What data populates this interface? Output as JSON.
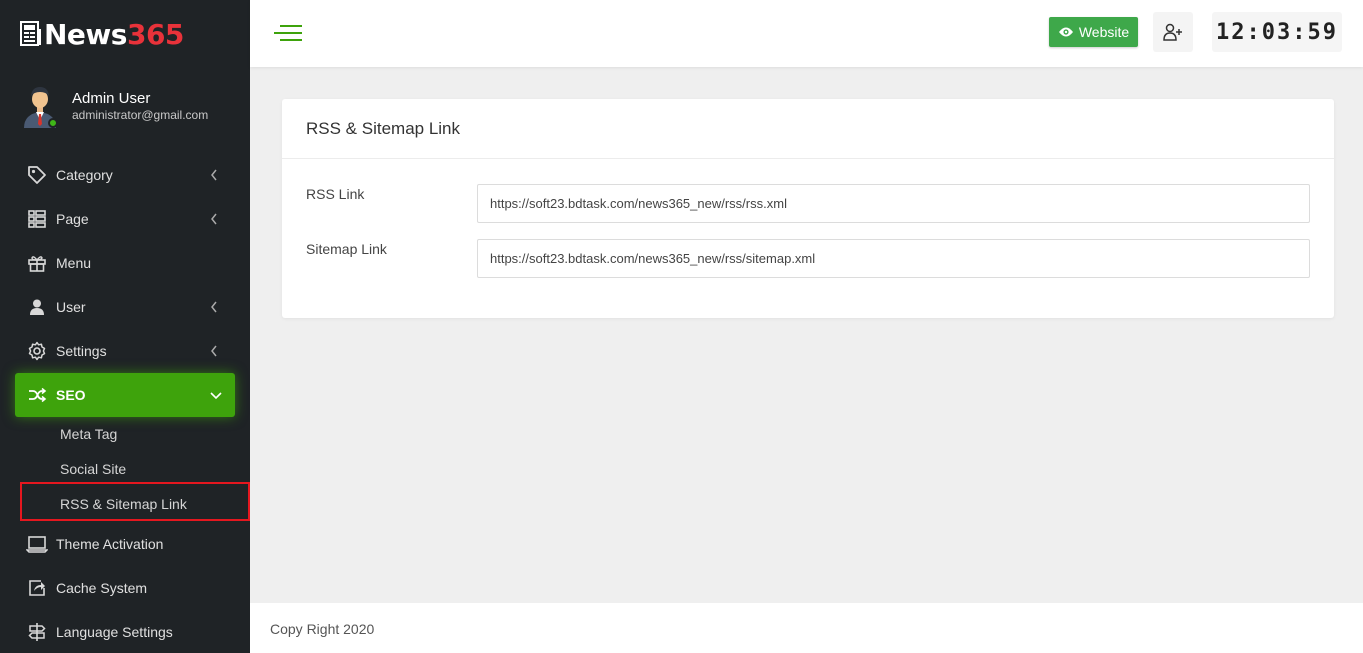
{
  "brand": {
    "name_white": "News",
    "name_red": "365"
  },
  "user": {
    "name": "Admin User",
    "email": "administrator@gmail.com"
  },
  "nav": [
    {
      "label": "Category",
      "icon": "tag-icon",
      "has_submenu": true
    },
    {
      "label": "Page",
      "icon": "list-icon",
      "has_submenu": true
    },
    {
      "label": "Menu",
      "icon": "gift-icon",
      "has_submenu": false
    },
    {
      "label": "User",
      "icon": "user-icon",
      "has_submenu": true
    },
    {
      "label": "Settings",
      "icon": "gear-icon",
      "has_submenu": true
    },
    {
      "label": "SEO",
      "icon": "shuffle-icon",
      "has_submenu": true,
      "active": true
    },
    {
      "label": "Theme Activation",
      "icon": "laptop-icon",
      "has_submenu": false
    },
    {
      "label": "Cache System",
      "icon": "share-icon",
      "has_submenu": false
    },
    {
      "label": "Language Settings",
      "icon": "signpost-icon",
      "has_submenu": false
    }
  ],
  "seo_submenu": [
    "Meta Tag",
    "Social Site",
    "RSS & Sitemap Link"
  ],
  "header": {
    "website_label": "Website",
    "clock": "12:03:59"
  },
  "card": {
    "title": "RSS & Sitemap Link",
    "rss_label": "RSS Link",
    "rss_value": "https://soft23.bdtask.com/news365_new/rss/rss.xml",
    "sitemap_label": "Sitemap Link",
    "sitemap_value": "https://soft23.bdtask.com/news365_new/rss/sitemap.xml"
  },
  "footer": {
    "text": "Copy Right 2020"
  },
  "colors": {
    "accent": "#3ea30c",
    "sidebar_bg": "#1f2326",
    "brand_red": "#e8323a",
    "website_button": "#3ea84a"
  }
}
